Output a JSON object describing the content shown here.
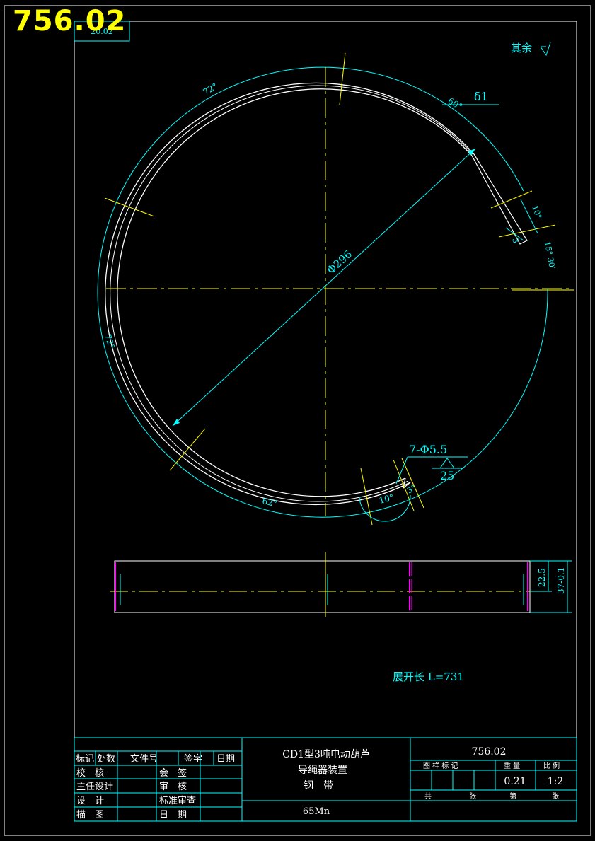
{
  "drawing_number": "756.02",
  "corner_code": "20.02",
  "surface_note": "其余",
  "dims": {
    "angle_72_top": "72°",
    "angle_60": "60°",
    "thickness": "δ1",
    "angle_10_right": "10°",
    "dim_3_right": "3",
    "angle_15_30": "15° 30′",
    "diameter": "Φ296",
    "angle_72_left": "72°",
    "angle_62": "62°",
    "angle_10_bottom": "10°",
    "angle_3_bottom": "3°",
    "holes": "7-Φ5.5",
    "holes_sub": "25",
    "width_inner": "22.5",
    "width_outer": "37-0.1"
  },
  "unfolded_length": "展开长 L=731",
  "title_block": {
    "mark": "标记",
    "location": "处数",
    "file_no": "文件号",
    "signature": "签字",
    "date": "日期",
    "check": "校　核",
    "countersign": "会　签",
    "chief_design": "主任设计",
    "review": "审　核",
    "design": "设　计",
    "std_review": "标准审查",
    "trace": "描　图",
    "date2": "日　期",
    "product_line1": "CD1型3吨电动葫芦",
    "product_line2": "导绳器装置",
    "part_name": "钢　带",
    "material": "65Mn",
    "drawing_no": "756.02",
    "sample_mark": "图 样 标 记",
    "weight_label": "重 量",
    "scale_label": "比 例",
    "weight": "0.21",
    "scale": "1:2",
    "total": "共",
    "sheet": "张",
    "page": "第",
    "sheet2": "张"
  }
}
